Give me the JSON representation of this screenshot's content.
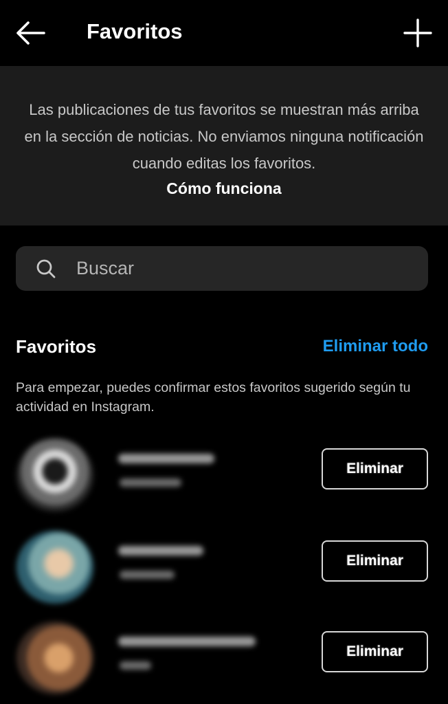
{
  "header": {
    "title": "Favoritos",
    "back_icon": "arrow-left-icon",
    "add_icon": "plus-icon"
  },
  "info": {
    "text": "Las publicaciones de tus favoritos se muestran más arriba en la sección de noticias. No enviamos ninguna notificación cuando editas los favoritos.",
    "link": "Cómo funciona"
  },
  "search": {
    "placeholder": "Buscar",
    "value": "",
    "icon": "search-icon"
  },
  "favorites": {
    "title": "Favoritos",
    "clear_all_label": "Eliminar todo",
    "description": "Para empezar, puedes confirmar estos favoritos sugerido según tu actividad en Instagram.",
    "items": [
      {
        "remove_label": "Eliminar"
      },
      {
        "remove_label": "Eliminar"
      },
      {
        "remove_label": "Eliminar"
      }
    ]
  },
  "colors": {
    "background": "#000000",
    "banner": "#1c1c1c",
    "search_bg": "#262626",
    "link_blue": "#1f9cf0",
    "text_secondary": "#c8c8c8"
  }
}
